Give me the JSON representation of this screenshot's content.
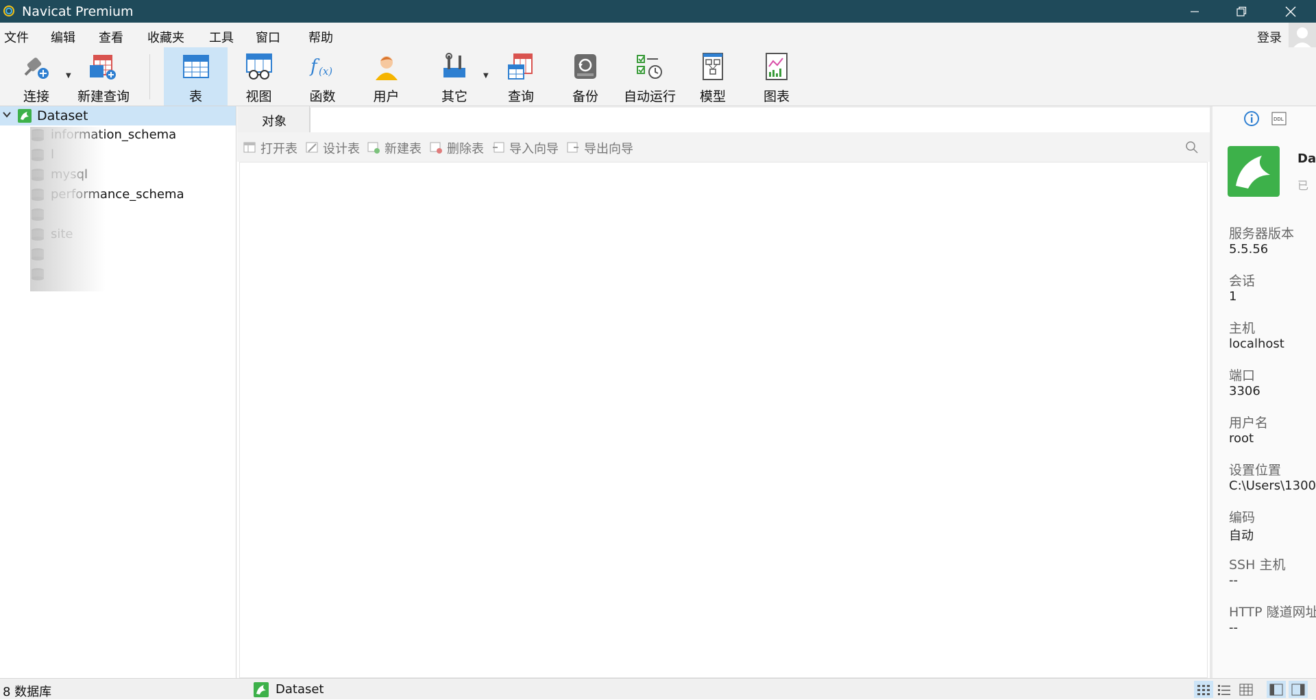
{
  "window": {
    "title": "Navicat Premium",
    "controls": [
      "minimize-icon",
      "restore-icon",
      "close-icon"
    ]
  },
  "menu": [
    "文件",
    "编辑",
    "查看",
    "收藏夹",
    "工具",
    "窗口",
    "帮助"
  ],
  "account": {
    "login_label": "登录"
  },
  "toolbar": {
    "connect": "连接",
    "new_query": "新建查询",
    "table": "表",
    "view": "视图",
    "function": "函数",
    "user": "用户",
    "other": "其它",
    "query": "查询",
    "backup": "备份",
    "automation": "自动运行",
    "model": "模型",
    "chart": "图表",
    "active": "表"
  },
  "navigator": {
    "connection": "Dataset",
    "databases": [
      "information_schema",
      "l",
      "mysql",
      "performance_schema",
      "",
      "site",
      "",
      ""
    ]
  },
  "tabs": {
    "objects": "对象"
  },
  "object_toolbar": {
    "open_table": "打开表",
    "design_table": "设计表",
    "new_table": "新建表",
    "delete_table": "删除表",
    "import_wizard": "导入向导",
    "export_wizard": "导出向导"
  },
  "info": {
    "title": "Da",
    "subtitle": "已",
    "fields": [
      {
        "label": "服务器版本",
        "value": "5.5.56"
      },
      {
        "label": "会话",
        "value": "1"
      },
      {
        "label": "主机",
        "value": "localhost"
      },
      {
        "label": "端口",
        "value": "3306"
      },
      {
        "label": "用户名",
        "value": "root"
      },
      {
        "label": "设置位置",
        "value": "C:\\Users\\1300"
      },
      {
        "label": "编码",
        "value": "自动"
      },
      {
        "label": "SSH 主机",
        "value": "--"
      },
      {
        "label": "HTTP 隧道网址",
        "value": "--"
      }
    ]
  },
  "status": {
    "db_count": "8 数据库",
    "connection": "Dataset"
  },
  "colors": {
    "titlebar": "#1f4a5a",
    "selected": "#cce4f7",
    "mysql_green": "#3db14a"
  }
}
